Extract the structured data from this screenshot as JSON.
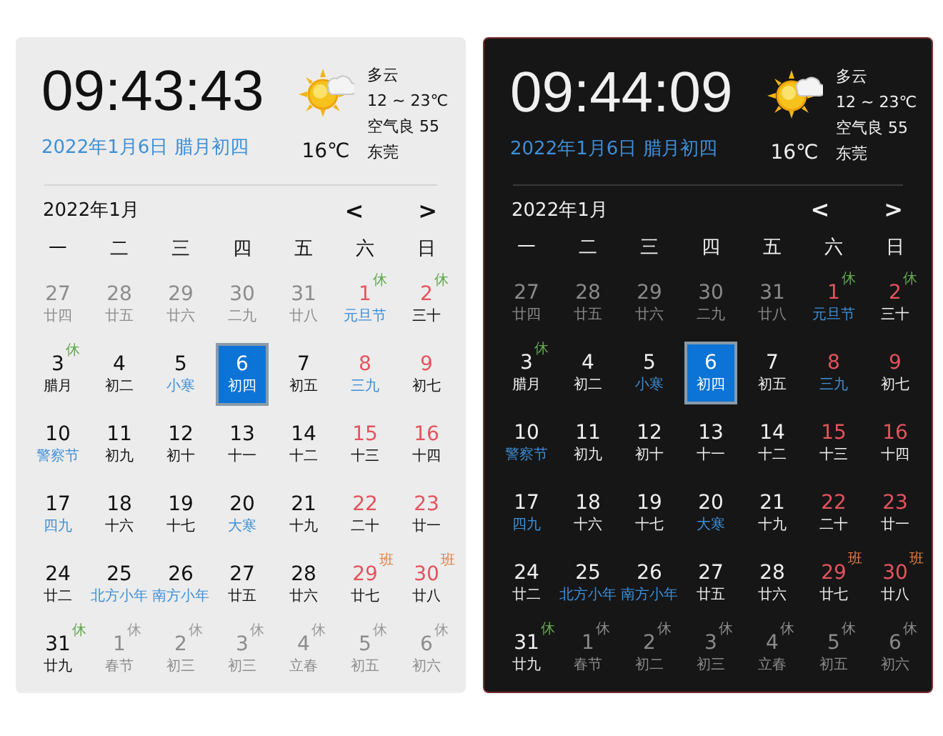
{
  "panels": [
    {
      "dark_mode": false,
      "time": "09:43:43",
      "date": "2022年1月6日 腊月初四",
      "weather": {
        "temperature": "16℃",
        "condition": "多云",
        "range": "12 ~ 23℃",
        "air": "空气良 55",
        "city": "东莞"
      },
      "month": "2022年1月",
      "prev": "<",
      "next": ">",
      "weekdays": [
        "一",
        "二",
        "三",
        "四",
        "五",
        "六",
        "日"
      ],
      "days": [
        {
          "day": "27",
          "lunar": "廿四",
          "kind": "adjacent",
          "festival": false,
          "selected": false
        },
        {
          "day": "28",
          "lunar": "廿五",
          "kind": "adjacent",
          "festival": false,
          "selected": false
        },
        {
          "day": "29",
          "lunar": "廿六",
          "kind": "adjacent",
          "festival": false,
          "selected": false
        },
        {
          "day": "30",
          "lunar": "二九",
          "kind": "adjacent",
          "festival": false,
          "selected": false
        },
        {
          "day": "31",
          "lunar": "廿八",
          "kind": "adjacent",
          "festival": false,
          "selected": false
        },
        {
          "day": "1",
          "lunar": "元旦节",
          "kind": "weekend",
          "festival": true,
          "selected": false,
          "tag": {
            "text": "休",
            "kind": "rest"
          }
        },
        {
          "day": "2",
          "lunar": "三十",
          "kind": "weekend",
          "festival": false,
          "selected": false,
          "tag": {
            "text": "休",
            "kind": "rest"
          }
        },
        {
          "day": "3",
          "lunar": "腊月",
          "kind": "weekday",
          "festival": false,
          "selected": false,
          "tag": {
            "text": "休",
            "kind": "rest"
          }
        },
        {
          "day": "4",
          "lunar": "初二",
          "kind": "weekday",
          "festival": false,
          "selected": false
        },
        {
          "day": "5",
          "lunar": "小寒",
          "kind": "weekday",
          "festival": true,
          "selected": false
        },
        {
          "day": "6",
          "lunar": "初四",
          "kind": "weekday",
          "festival": false,
          "selected": true
        },
        {
          "day": "7",
          "lunar": "初五",
          "kind": "weekday",
          "festival": false,
          "selected": false
        },
        {
          "day": "8",
          "lunar": "三九",
          "kind": "weekend",
          "festival": true,
          "selected": false
        },
        {
          "day": "9",
          "lunar": "初七",
          "kind": "weekend",
          "festival": false,
          "selected": false
        },
        {
          "day": "10",
          "lunar": "警察节",
          "kind": "weekday",
          "festival": true,
          "selected": false
        },
        {
          "day": "11",
          "lunar": "初九",
          "kind": "weekday",
          "festival": false,
          "selected": false
        },
        {
          "day": "12",
          "lunar": "初十",
          "kind": "weekday",
          "festival": false,
          "selected": false
        },
        {
          "day": "13",
          "lunar": "十一",
          "kind": "weekday",
          "festival": false,
          "selected": false
        },
        {
          "day": "14",
          "lunar": "十二",
          "kind": "weekday",
          "festival": false,
          "selected": false
        },
        {
          "day": "15",
          "lunar": "十三",
          "kind": "weekend",
          "festival": false,
          "selected": false
        },
        {
          "day": "16",
          "lunar": "十四",
          "kind": "weekend",
          "festival": false,
          "selected": false
        },
        {
          "day": "17",
          "lunar": "四九",
          "kind": "weekday",
          "festival": true,
          "selected": false
        },
        {
          "day": "18",
          "lunar": "十六",
          "kind": "weekday",
          "festival": false,
          "selected": false
        },
        {
          "day": "19",
          "lunar": "十七",
          "kind": "weekday",
          "festival": false,
          "selected": false
        },
        {
          "day": "20",
          "lunar": "大寒",
          "kind": "weekday",
          "festival": true,
          "selected": false
        },
        {
          "day": "21",
          "lunar": "十九",
          "kind": "weekday",
          "festival": false,
          "selected": false
        },
        {
          "day": "22",
          "lunar": "二十",
          "kind": "weekend",
          "festival": false,
          "selected": false
        },
        {
          "day": "23",
          "lunar": "廿一",
          "kind": "weekend",
          "festival": false,
          "selected": false
        },
        {
          "day": "24",
          "lunar": "廿二",
          "kind": "weekday",
          "festival": false,
          "selected": false
        },
        {
          "day": "25",
          "lunar": "北方小年",
          "kind": "weekday",
          "festival": true,
          "selected": false
        },
        {
          "day": "26",
          "lunar": "南方小年",
          "kind": "weekday",
          "festival": true,
          "selected": false
        },
        {
          "day": "27",
          "lunar": "廿五",
          "kind": "weekday",
          "festival": false,
          "selected": false
        },
        {
          "day": "28",
          "lunar": "廿六",
          "kind": "weekday",
          "festival": false,
          "selected": false
        },
        {
          "day": "29",
          "lunar": "廿七",
          "kind": "weekend",
          "festival": false,
          "selected": false,
          "tag": {
            "text": "班",
            "kind": "work"
          }
        },
        {
          "day": "30",
          "lunar": "廿八",
          "kind": "weekend",
          "festival": false,
          "selected": false,
          "tag": {
            "text": "班",
            "kind": "work"
          }
        },
        {
          "day": "31",
          "lunar": "廿九",
          "kind": "weekday",
          "festival": false,
          "selected": false,
          "tag": {
            "text": "休",
            "kind": "rest"
          }
        },
        {
          "day": "1",
          "lunar": "春节",
          "kind": "adjacent",
          "festival": false,
          "selected": false,
          "tag": {
            "text": "休",
            "kind": "rest"
          }
        },
        {
          "day": "2",
          "lunar": "初三",
          "kind": "adjacent",
          "festival": false,
          "selected": false,
          "tag": {
            "text": "休",
            "kind": "rest"
          }
        },
        {
          "day": "3",
          "lunar": "初三",
          "kind": "adjacent",
          "festival": false,
          "selected": false,
          "tag": {
            "text": "休",
            "kind": "rest"
          }
        },
        {
          "day": "4",
          "lunar": "立春",
          "kind": "adjacent",
          "festival": false,
          "selected": false,
          "tag": {
            "text": "休",
            "kind": "rest"
          }
        },
        {
          "day": "5",
          "lunar": "初五",
          "kind": "adjacent",
          "festival": false,
          "selected": false,
          "tag": {
            "text": "休",
            "kind": "rest"
          }
        },
        {
          "day": "6",
          "lunar": "初六",
          "kind": "adjacent",
          "festival": false,
          "selected": false,
          "tag": {
            "text": "休",
            "kind": "rest"
          }
        }
      ]
    },
    {
      "dark_mode": true,
      "time": "09:44:09",
      "date": "2022年1月6日 腊月初四",
      "weather": {
        "temperature": "16℃",
        "condition": "多云",
        "range": "12 ~ 23℃",
        "air": "空气良 55",
        "city": "东莞"
      },
      "month": "2022年1月",
      "prev": "<",
      "next": ">",
      "weekdays": [
        "一",
        "二",
        "三",
        "四",
        "五",
        "六",
        "日"
      ],
      "days": [
        {
          "day": "27",
          "lunar": "廿四",
          "kind": "adjacent",
          "festival": false,
          "selected": false
        },
        {
          "day": "28",
          "lunar": "廿五",
          "kind": "adjacent",
          "festival": false,
          "selected": false
        },
        {
          "day": "29",
          "lunar": "廿六",
          "kind": "adjacent",
          "festival": false,
          "selected": false
        },
        {
          "day": "30",
          "lunar": "二九",
          "kind": "adjacent",
          "festival": false,
          "selected": false
        },
        {
          "day": "31",
          "lunar": "廿八",
          "kind": "adjacent",
          "festival": false,
          "selected": false
        },
        {
          "day": "1",
          "lunar": "元旦节",
          "kind": "weekend",
          "festival": true,
          "selected": false,
          "tag": {
            "text": "休",
            "kind": "rest"
          }
        },
        {
          "day": "2",
          "lunar": "三十",
          "kind": "weekend",
          "festival": false,
          "selected": false,
          "tag": {
            "text": "休",
            "kind": "rest"
          }
        },
        {
          "day": "3",
          "lunar": "腊月",
          "kind": "weekday",
          "festival": false,
          "selected": false,
          "tag": {
            "text": "休",
            "kind": "rest"
          }
        },
        {
          "day": "4",
          "lunar": "初二",
          "kind": "weekday",
          "festival": false,
          "selected": false
        },
        {
          "day": "5",
          "lunar": "小寒",
          "kind": "weekday",
          "festival": true,
          "selected": false
        },
        {
          "day": "6",
          "lunar": "初四",
          "kind": "weekday",
          "festival": false,
          "selected": true
        },
        {
          "day": "7",
          "lunar": "初五",
          "kind": "weekday",
          "festival": false,
          "selected": false
        },
        {
          "day": "8",
          "lunar": "三九",
          "kind": "weekend",
          "festival": true,
          "selected": false
        },
        {
          "day": "9",
          "lunar": "初七",
          "kind": "weekend",
          "festival": false,
          "selected": false
        },
        {
          "day": "10",
          "lunar": "警察节",
          "kind": "weekday",
          "festival": true,
          "selected": false
        },
        {
          "day": "11",
          "lunar": "初九",
          "kind": "weekday",
          "festival": false,
          "selected": false
        },
        {
          "day": "12",
          "lunar": "初十",
          "kind": "weekday",
          "festival": false,
          "selected": false
        },
        {
          "day": "13",
          "lunar": "十一",
          "kind": "weekday",
          "festival": false,
          "selected": false
        },
        {
          "day": "14",
          "lunar": "十二",
          "kind": "weekday",
          "festival": false,
          "selected": false
        },
        {
          "day": "15",
          "lunar": "十三",
          "kind": "weekend",
          "festival": false,
          "selected": false
        },
        {
          "day": "16",
          "lunar": "十四",
          "kind": "weekend",
          "festival": false,
          "selected": false
        },
        {
          "day": "17",
          "lunar": "四九",
          "kind": "weekday",
          "festival": true,
          "selected": false
        },
        {
          "day": "18",
          "lunar": "十六",
          "kind": "weekday",
          "festival": false,
          "selected": false
        },
        {
          "day": "19",
          "lunar": "十七",
          "kind": "weekday",
          "festival": false,
          "selected": false
        },
        {
          "day": "20",
          "lunar": "大寒",
          "kind": "weekday",
          "festival": true,
          "selected": false
        },
        {
          "day": "21",
          "lunar": "十九",
          "kind": "weekday",
          "festival": false,
          "selected": false
        },
        {
          "day": "22",
          "lunar": "二十",
          "kind": "weekend",
          "festival": false,
          "selected": false
        },
        {
          "day": "23",
          "lunar": "廿一",
          "kind": "weekend",
          "festival": false,
          "selected": false
        },
        {
          "day": "24",
          "lunar": "廿二",
          "kind": "weekday",
          "festival": false,
          "selected": false
        },
        {
          "day": "25",
          "lunar": "北方小年",
          "kind": "weekday",
          "festival": true,
          "selected": false
        },
        {
          "day": "26",
          "lunar": "南方小年",
          "kind": "weekday",
          "festival": true,
          "selected": false
        },
        {
          "day": "27",
          "lunar": "廿五",
          "kind": "weekday",
          "festival": false,
          "selected": false
        },
        {
          "day": "28",
          "lunar": "廿六",
          "kind": "weekday",
          "festival": false,
          "selected": false
        },
        {
          "day": "29",
          "lunar": "廿七",
          "kind": "weekend",
          "festival": false,
          "selected": false,
          "tag": {
            "text": "班",
            "kind": "work"
          }
        },
        {
          "day": "30",
          "lunar": "廿八",
          "kind": "weekend",
          "festival": false,
          "selected": false,
          "tag": {
            "text": "班",
            "kind": "work"
          }
        },
        {
          "day": "31",
          "lunar": "廿九",
          "kind": "weekday",
          "festival": false,
          "selected": false,
          "tag": {
            "text": "休",
            "kind": "rest"
          }
        },
        {
          "day": "1",
          "lunar": "春节",
          "kind": "adjacent",
          "festival": false,
          "selected": false,
          "tag": {
            "text": "休",
            "kind": "rest"
          }
        },
        {
          "day": "2",
          "lunar": "初二",
          "kind": "adjacent",
          "festival": false,
          "selected": false,
          "tag": {
            "text": "休",
            "kind": "rest"
          }
        },
        {
          "day": "3",
          "lunar": "初三",
          "kind": "adjacent",
          "festival": false,
          "selected": false,
          "tag": {
            "text": "休",
            "kind": "rest"
          }
        },
        {
          "day": "4",
          "lunar": "立春",
          "kind": "adjacent",
          "festival": false,
          "selected": false,
          "tag": {
            "text": "休",
            "kind": "rest"
          }
        },
        {
          "day": "5",
          "lunar": "初五",
          "kind": "adjacent",
          "festival": false,
          "selected": false,
          "tag": {
            "text": "休",
            "kind": "rest"
          }
        },
        {
          "day": "6",
          "lunar": "初六",
          "kind": "adjacent",
          "festival": false,
          "selected": false,
          "tag": {
            "text": "休",
            "kind": "rest"
          }
        }
      ]
    }
  ]
}
